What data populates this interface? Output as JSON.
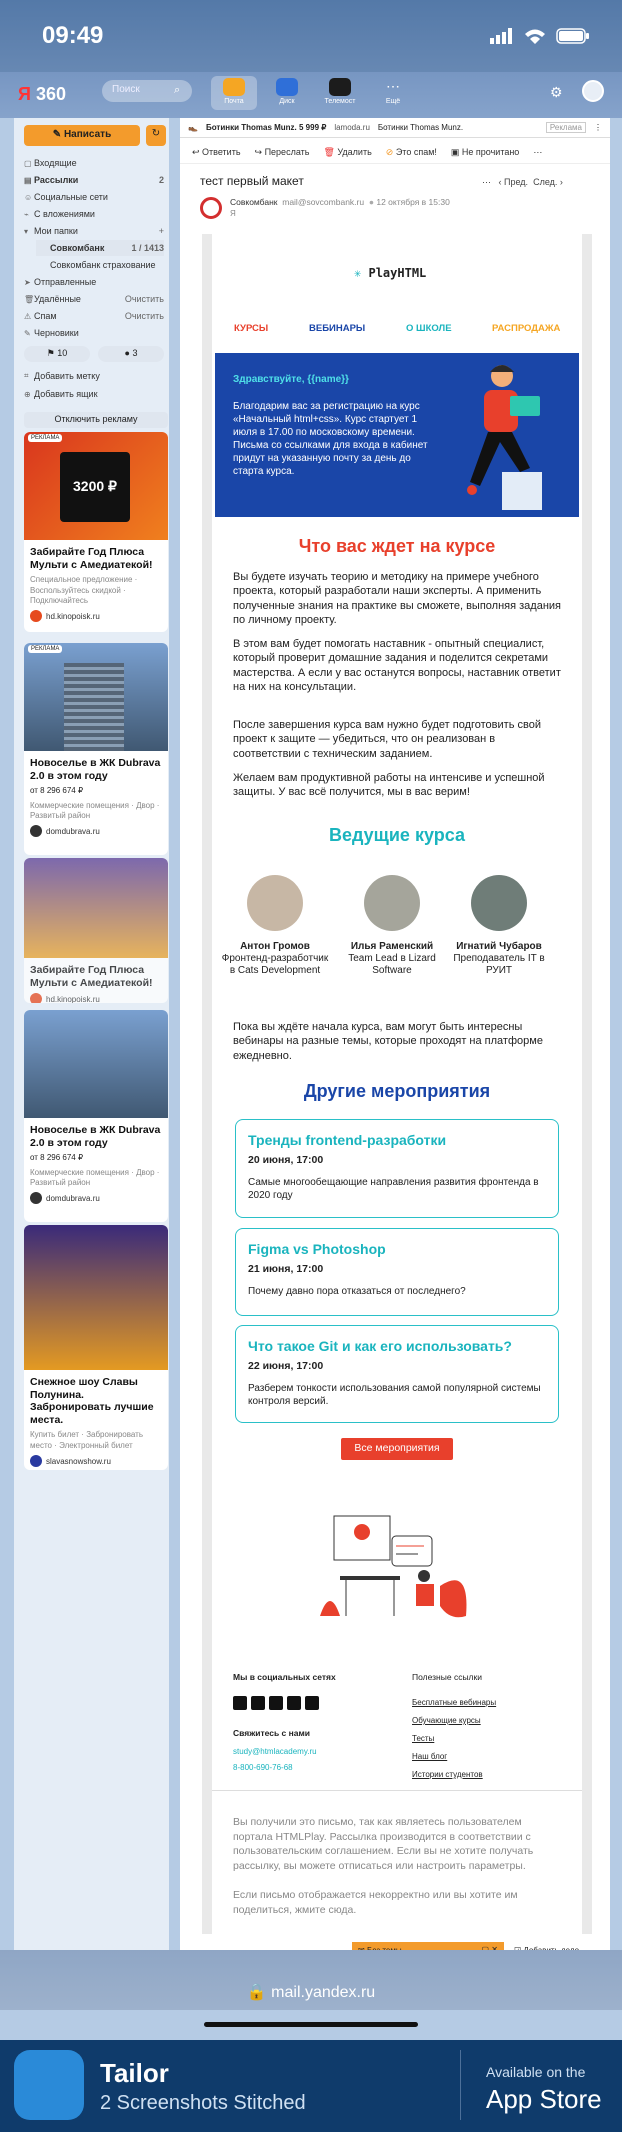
{
  "status": {
    "time": "09:49"
  },
  "header": {
    "logo_ya": "Я",
    "logo_360": "360",
    "search_placeholder": "Поиск",
    "services": [
      {
        "label": "Почта",
        "color": "#f5a623"
      },
      {
        "label": "Диск",
        "color": "#2f6fd8"
      },
      {
        "label": "Телемост",
        "color": "#1c1c1c"
      },
      {
        "label": "Ещё",
        "color": "#7f9cc6"
      }
    ]
  },
  "sidebar": {
    "write": "Написать",
    "folders": [
      {
        "label": "Входящие",
        "count": ""
      },
      {
        "label": "Рассылки",
        "count": "2"
      },
      {
        "label": "Социальные сети",
        "count": ""
      },
      {
        "label": "С вложениями",
        "count": ""
      },
      {
        "label": "Мои папки",
        "count": ""
      },
      {
        "label": "Совкомбанк",
        "count": "1 / 1413"
      },
      {
        "label": "Совкомбанк страхование",
        "count": ""
      },
      {
        "label": "Отправленные",
        "count": ""
      },
      {
        "label": "Удалённые",
        "count": "Очистить"
      },
      {
        "label": "Спам",
        "count": "Очистить"
      },
      {
        "label": "Черновики",
        "count": ""
      }
    ],
    "tags": [
      "10",
      "3"
    ],
    "add_tag": "Добавить метку",
    "add_box": "Добавить ящик",
    "disable_ads": "Отключить рекламу"
  },
  "ads": [
    {
      "badge": "РЕКЛАМА",
      "title": "Забирайте Год Плюса Мульти с Амедиатекой!",
      "sub": "Специальное предложение · Воспользуйтесь скидкой · Подключайтесь",
      "src": "hd.kinopoisk.ru",
      "price": "3200 ₽"
    },
    {
      "badge": "РЕКЛАМА",
      "title": "Новоселье в ЖК Dubrava 2.0 в этом году",
      "sub": "от 8 296 674 ₽",
      "sub2": "Коммерческие помещения · Двор · Развитый район",
      "src": "domdubrava.ru"
    },
    {
      "badge": "",
      "title": "Забирайте Год Плюса Мульти с Амедиатекой!",
      "sub": "",
      "src": "hd.kinopoisk.ru"
    },
    {
      "badge": "",
      "title": "Новоселье в ЖК Dubrava 2.0 в этом году",
      "sub": "от 8 296 674 ₽",
      "sub2": "Коммерческие помещения · Двор · Развитый район",
      "src": "domdubrava.ru"
    },
    {
      "badge": "",
      "title": "Снежное шоу Славы Полунина. Забронировать лучшие места.",
      "sub": "Купить билет · Забронировать место · Электронный билет",
      "src": "slavasnowshow.ru"
    }
  ],
  "mail": {
    "top_ad": "Ботинки Thomas Munz. 5 999 ₽",
    "top_ad_src": "lamoda.ru",
    "top_ad_brand": "Ботинки Thomas Munz.",
    "top_ad_label": "Реклама",
    "toolbar": [
      "Ответить",
      "Переслать",
      "Удалить",
      "Это спам!",
      "Не прочитано"
    ],
    "subject": "тест первый макет",
    "prev": "Пред.",
    "next": "След.",
    "sender": "Совкомбанк",
    "sender_email": "mail@sovcombank.ru",
    "date": "12 октября в 15:30",
    "to": "Я"
  },
  "letter": {
    "brand": "PlayHTML",
    "nav": [
      "КУРСЫ",
      "ВЕБИНАРЫ",
      "О ШКОЛЕ",
      "РАСПРОДАЖА"
    ],
    "greet": "Здравствуйте, {{name}}",
    "hero_text": "Благодарим вас за регистрацию на курс «Начальный html+css». Курс стартует 1 июля в 17.00 по московскому времени. Письма со ссылками для входа в кабинет придут на указанную почту за день до старта курса.",
    "h_what": "Что вас ждет на курсе",
    "p1": "Вы будете изучать теорию и методику на примере учебного проекта, который разработали наши эксперты. А применить полученные знания на практике вы сможете, выполняя задания по личному проекту.",
    "p2": "В этом вам будет помогать наставник - опытный специалист, который проверит домашние задания и поделится секретами мастерства. А если у вас останутся вопросы, наставник ответит на них на консультации.",
    "p3": "После завершения курса вам нужно будет подготовить свой проект к защите — убедиться, что он реализован в соответствии с техническим заданием.",
    "p4": "Желаем вам продуктивной работы на интенсиве и успешной защиты. У вас всё получится, мы в вас верим!",
    "h_teachers": "Ведущие курса",
    "teachers": [
      {
        "name": "Антон Громов",
        "role": "Фронтенд-разработчик в Cats Development"
      },
      {
        "name": "Илья Раменский",
        "role": "Team Lead в Lizard Software"
      },
      {
        "name": "Игнатий Чубаров",
        "role": "Преподаватель IT в РУИТ"
      }
    ],
    "p5": "Пока вы ждёте начала курса, вам могут быть интересны вебинары на разные темы, которые проходят на платформе ежедневно.",
    "h_events": "Другие мероприятия",
    "events": [
      {
        "title": "Тренды frontend-разработки",
        "date": "20 июня, 17:00",
        "text": "Самые многообещающие направления развития фронтенда в 2020 году"
      },
      {
        "title": "Figma vs Photoshop",
        "date": "21 июня, 17:00",
        "text": "Почему давно пора отказаться от последнего?"
      },
      {
        "title": "Что такое Git и как его использовать?",
        "date": "22 июня, 17:00",
        "text": "Разберем тонкости использования самой популярной системы контроля версий."
      }
    ],
    "all_events": "Все мероприятия",
    "social_h": "Мы в социальных сетях",
    "contact_h": "Свяжитесь с нами",
    "email": "study@htmlacademy.ru",
    "phone": "8-800-690-76-68",
    "links_h": "Полезные ссылки",
    "links": [
      "Бесплатные вебинары",
      "Обучающие курсы",
      "Тесты",
      "Наш блог",
      "Истории студентов"
    ],
    "foot1": "Вы получили это письмо, так как являетесь пользователем портала HTMLPlay. Рассылка производится в соответствии с пользовательским соглашением. Если вы не хотите получать рассылку, вы можете отписаться или настроить параметры.",
    "foot2": "Если письмо отображается некорректно или вы хотите им поделиться, жмите сюда."
  },
  "compose": {
    "draft": "Без темы",
    "add_case": "Добавить дело"
  },
  "browser": {
    "url": "mail.yandex.ru"
  },
  "banner": {
    "app": "Tailor",
    "sub": "2 Screenshots Stitched",
    "avail": "Available on the",
    "store": "App Store"
  }
}
